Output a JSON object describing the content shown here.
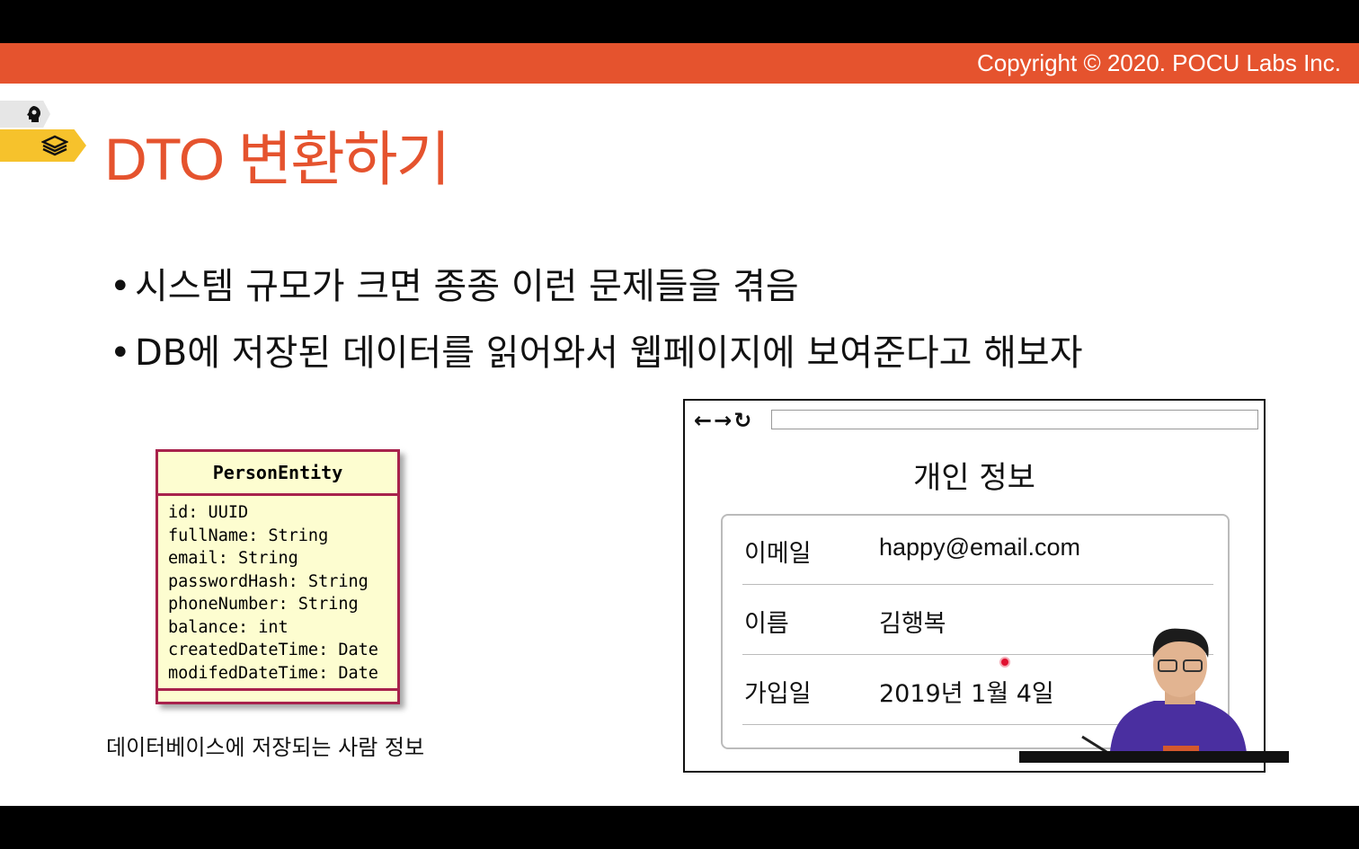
{
  "header": {
    "copyright": "Copyright © 2020. POCU Labs Inc."
  },
  "slide": {
    "title": "DTO 변환하기",
    "bullets": [
      "시스템 규모가 크면 종종 이런 문제들을 겪음",
      "DB에 저장된 데이터를 읽어와서 웹페이지에 보여준다고 해보자"
    ]
  },
  "uml": {
    "class_name": "PersonEntity",
    "fields": [
      "id: UUID",
      "fullName: String",
      "email: String",
      "passwordHash: String",
      "phoneNumber: String",
      "balance: int",
      "createdDateTime: Date",
      "modifedDateTime: Date"
    ],
    "caption": "데이터베이스에 저장되는 사람 정보"
  },
  "browser": {
    "nav": {
      "back": "←",
      "forward": "→",
      "reload": "↻"
    },
    "page_title": "개인 정보",
    "rows": [
      {
        "label": "이메일",
        "value": "happy@email.com"
      },
      {
        "label": "이름",
        "value": "김행복"
      },
      {
        "label": "가입일",
        "value": "2019년 1월 4일"
      }
    ]
  },
  "icons": {
    "tab1": "head-gear-icon",
    "tab2": "stack-icon"
  },
  "colors": {
    "accent": "#e5532e",
    "uml_border": "#a8224c",
    "uml_fill": "#fdfdd0",
    "tab_highlight": "#f6c22c"
  }
}
